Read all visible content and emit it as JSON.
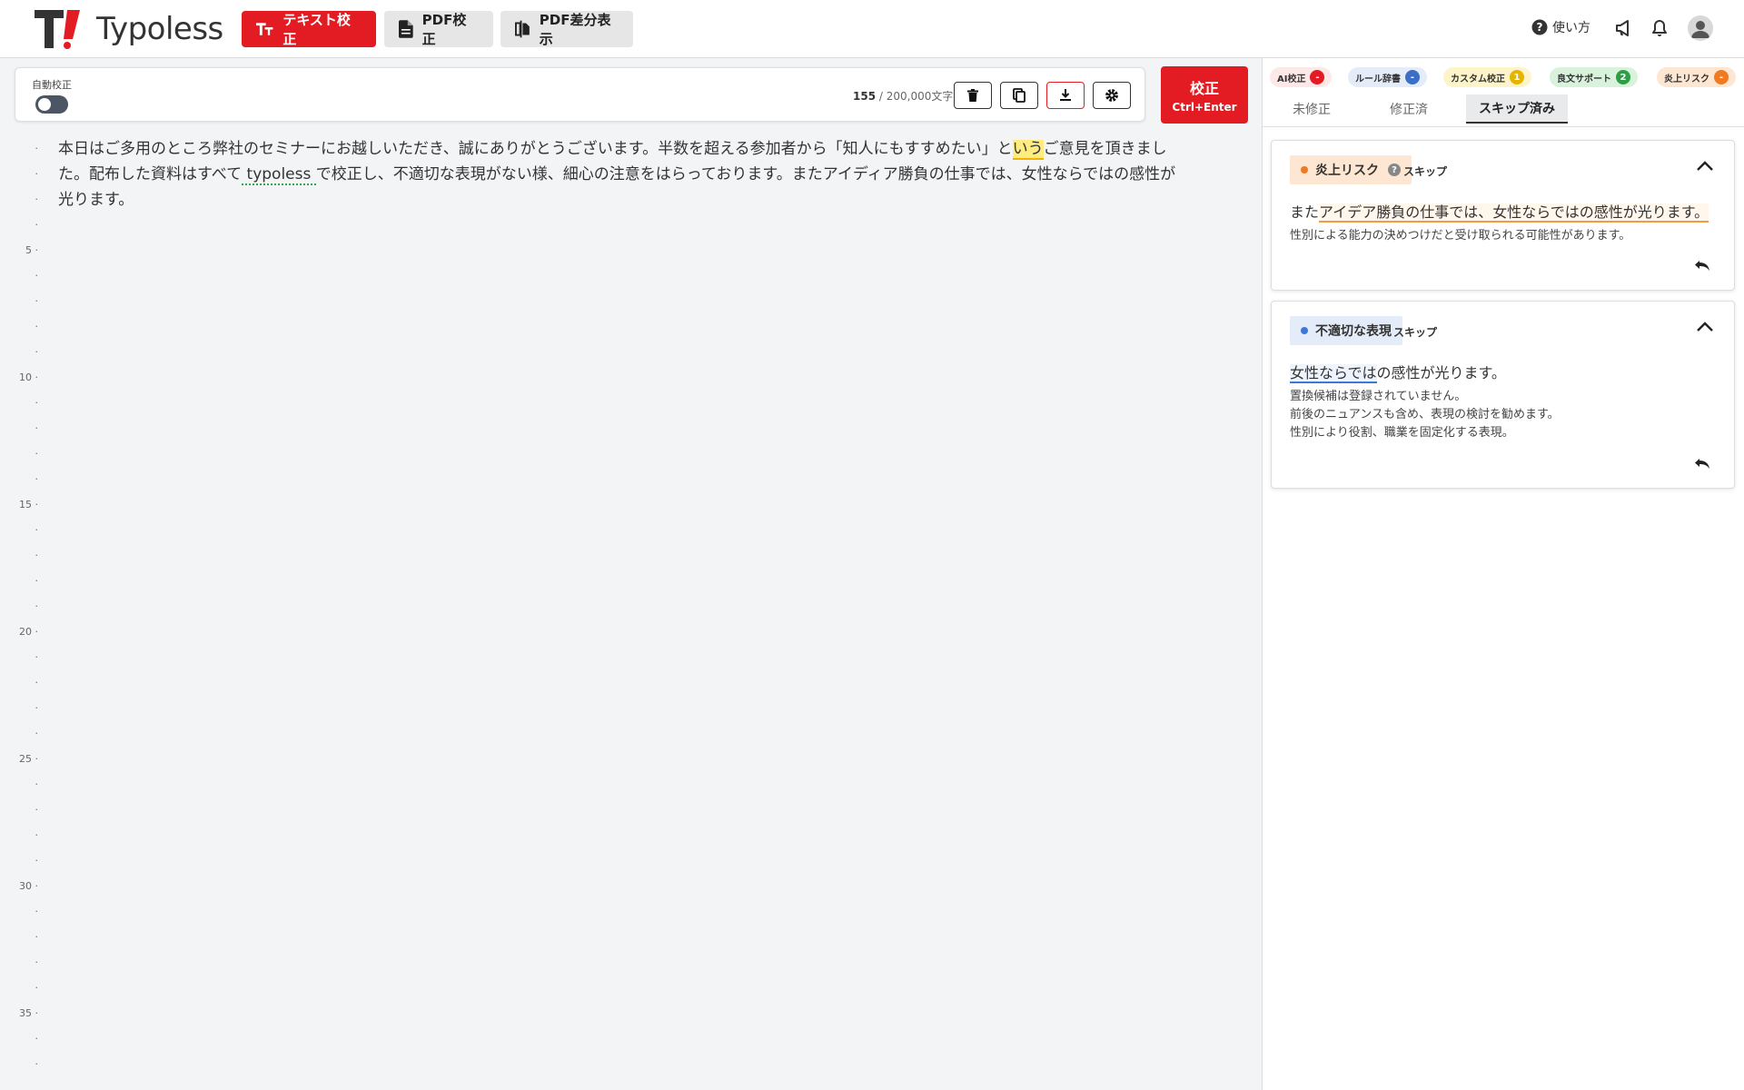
{
  "app": {
    "brand": "Typoless"
  },
  "nav": {
    "text_check": "テキスト校正",
    "pdf_check": "PDF校正",
    "pdf_diff": "PDF差分表示"
  },
  "header": {
    "help_label": "使い方"
  },
  "toolbar": {
    "auto_label": "自動校正",
    "count_current": "155",
    "count_sep": " / ",
    "count_limit": "200,000文字"
  },
  "check_button": {
    "label": "校正",
    "shortcut": "Ctrl+Enter"
  },
  "editor": {
    "line_numbers": [
      "5",
      "10",
      "15",
      "20",
      "25",
      "30",
      "35"
    ],
    "line1_a": "本日はご多用のところ弊社のセミナーにお越しいただき、誠にありがとうございます。半数を超える参加者から「知人にもすすめたい」と",
    "line1_hl": "いう",
    "line1_b": "ご意見を頂きまし",
    "line2_a": "た。配布した資料はすべて",
    "line2_ul": " typoless ",
    "line2_b": "で校正し、不適切な表現がない様、細心の注意をはらっております。またアイディア勝負の仕事では、女性ならではの感性が",
    "line3": "光ります。"
  },
  "categories": [
    {
      "label": "AI校正",
      "badge": "-",
      "bg": "#fde8e8",
      "badge_color": "#e31b23"
    },
    {
      "label": "ルール辞書",
      "badge": "-",
      "bg": "#e3ecf8",
      "badge_color": "#3b6fc7"
    },
    {
      "label": "カスタム校正",
      "badge": "1",
      "bg": "#fdf5c9",
      "badge_color": "#e5b400"
    },
    {
      "label": "良文サポート",
      "badge": "2",
      "bg": "#d8f2dc",
      "badge_color": "#2e9e46"
    },
    {
      "label": "炎上リスク",
      "badge": "-",
      "bg": "#fde6d2",
      "badge_color": "#f07a22"
    }
  ],
  "tabs": [
    {
      "label": "未修正"
    },
    {
      "label": "修正済"
    },
    {
      "label": "スキップ済み"
    }
  ],
  "cards": [
    {
      "tag": "炎上リスク",
      "tag_help": "?",
      "skip": "スキップ",
      "sentence_pre": "また",
      "sentence_mark": "アイデア勝負の仕事では、女性ならではの感性が光ります。",
      "sentence_post": "",
      "notes": [
        "性別による能力の決めつけだと受け取られる可能性があります。"
      ]
    },
    {
      "tag": "不適切な表現",
      "skip": "スキップ",
      "sentence_pre": "",
      "sentence_mark": "女性ならでは",
      "sentence_post": "の感性が光ります。",
      "notes": [
        "置換候補は登録されていません。",
        "前後のニュアンスも含め、表現の検討を勧めます。",
        "性別により役割、職業を固定化する表現。"
      ]
    }
  ],
  "colors": {
    "brand_red": "#e31b23",
    "risk_orange": "#f07a22",
    "inappropriate_blue": "#3b78d8"
  }
}
